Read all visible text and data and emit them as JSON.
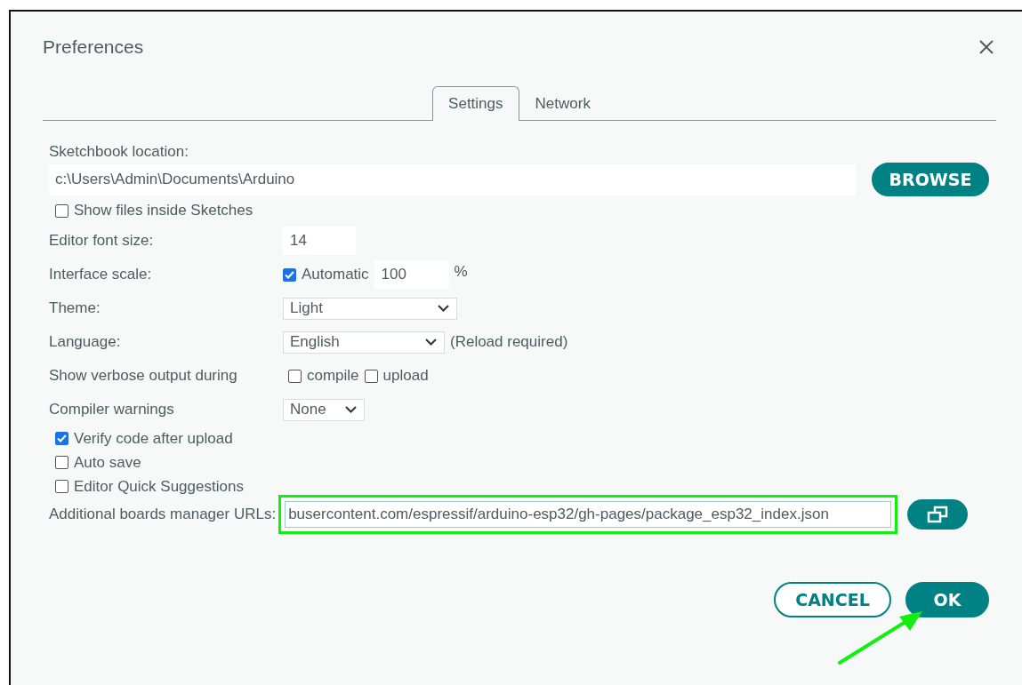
{
  "window": {
    "title": "Preferences"
  },
  "tabs": [
    {
      "label": "Settings",
      "selected": true
    },
    {
      "label": "Network",
      "selected": false
    }
  ],
  "sketchbook": {
    "label": "Sketchbook location:",
    "value": "c:\\Users\\Admin\\Documents\\Arduino",
    "browse": "BROWSE"
  },
  "show_files": {
    "label": "Show files inside Sketches",
    "checked": false
  },
  "rows": [
    {
      "kind": "input",
      "label": "Editor font size:",
      "value": "14"
    },
    {
      "kind": "scale",
      "label": "Interface scale:",
      "check_label": "Automatic",
      "checked": true,
      "value": "100",
      "unit": "%"
    },
    {
      "kind": "select",
      "label": "Theme:",
      "value": "Light"
    },
    {
      "kind": "select",
      "label": "Language:",
      "value": "English",
      "note": "(Reload required)"
    },
    {
      "kind": "checks",
      "label": "Show verbose output during",
      "options": [
        {
          "label": "compile",
          "checked": false
        },
        {
          "label": "upload",
          "checked": false
        }
      ]
    },
    {
      "kind": "select",
      "label": "Compiler warnings",
      "value": "None"
    }
  ],
  "options": [
    {
      "label": "Verify code after upload",
      "checked": true
    },
    {
      "label": "Auto save",
      "checked": false
    },
    {
      "label": "Editor Quick Suggestions",
      "checked": false
    }
  ],
  "urls": {
    "label": "Additional boards manager URLs:",
    "value": "busercontent.com/espressif/arduino-esp32/gh-pages/package_esp32_index.json",
    "highlighted": true
  },
  "buttons": [
    {
      "label": "CANCEL",
      "kind": "secondary"
    },
    {
      "label": "OK",
      "kind": "primary"
    }
  ],
  "annotation_arrow": true
}
